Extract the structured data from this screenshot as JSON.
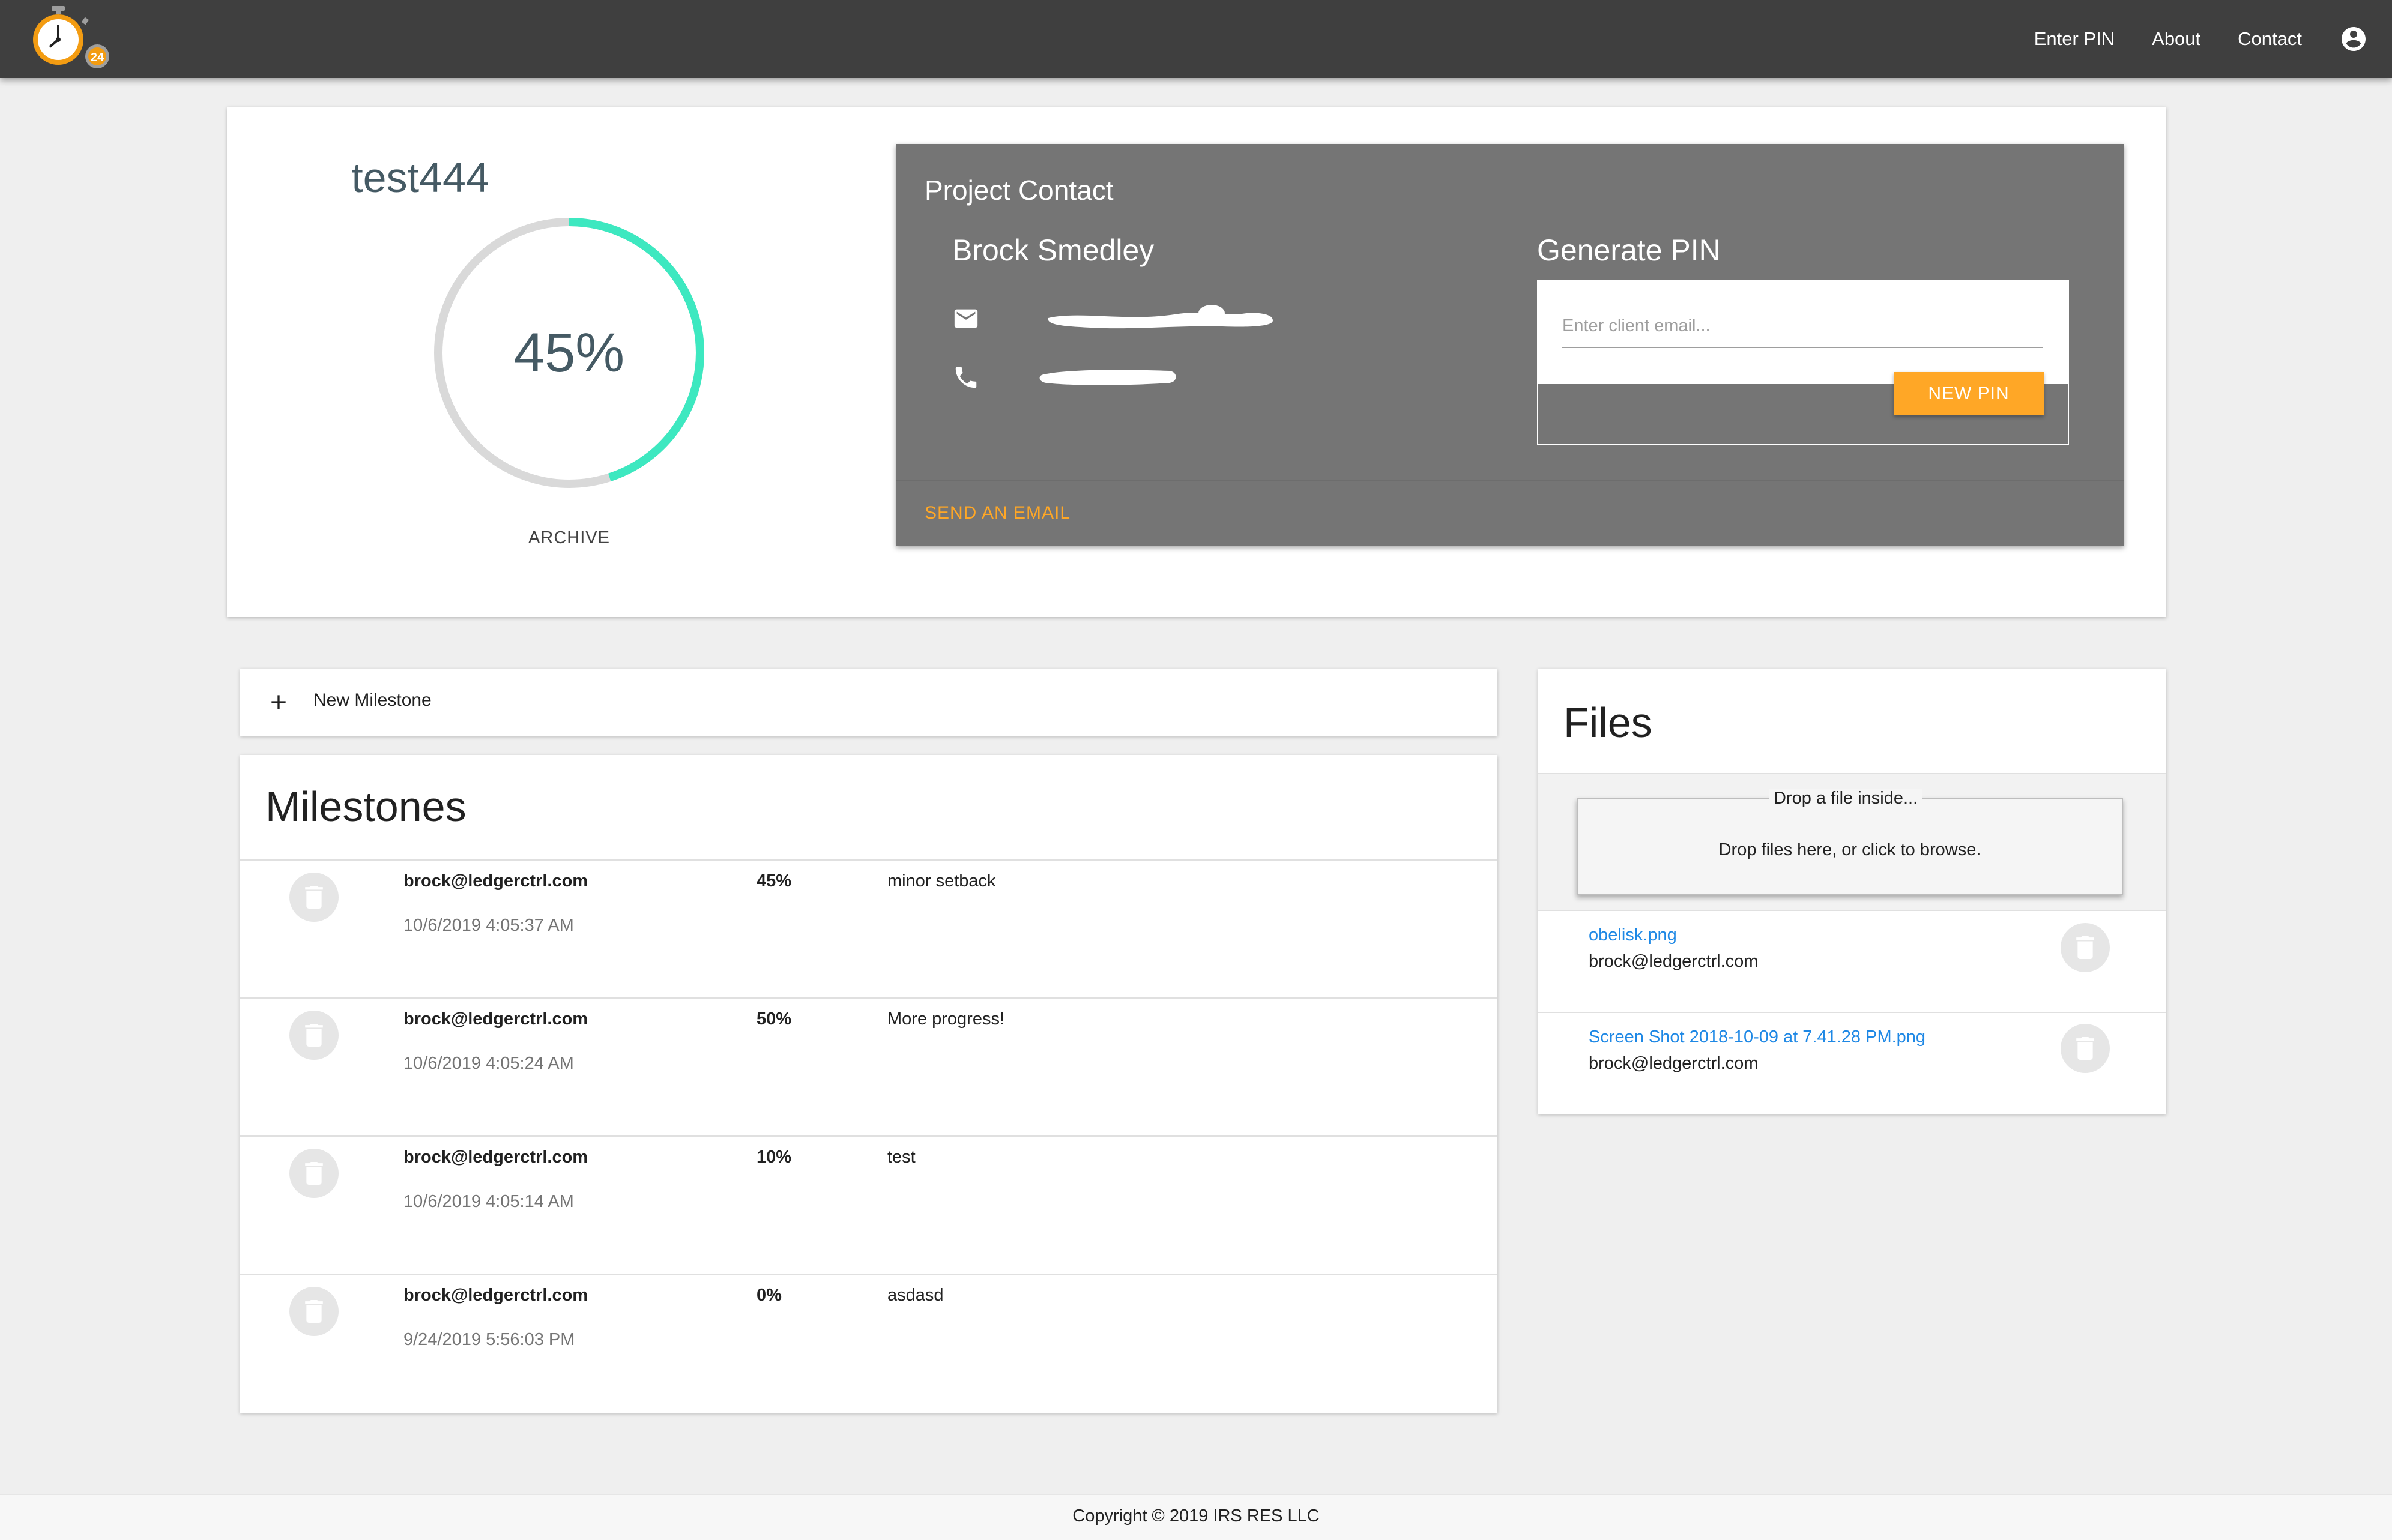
{
  "nav": {
    "items": [
      {
        "label": "Enter PIN"
      },
      {
        "label": "About"
      },
      {
        "label": "Contact"
      }
    ],
    "logo_badge": "24"
  },
  "project": {
    "name": "test444",
    "progress_text": "45%",
    "progress_fraction": 0.45,
    "archive_label": "ARCHIVE"
  },
  "contact": {
    "title": "Project Contact",
    "name": "Brock Smedley",
    "send_email_label": "SEND AN EMAIL"
  },
  "pin": {
    "title": "Generate PIN",
    "placeholder": "Enter client email...",
    "button_label": "NEW PIN"
  },
  "new_milestone": {
    "label": "New Milestone"
  },
  "milestones": {
    "title": "Milestones",
    "rows": [
      {
        "email": "brock@ledgerctrl.com",
        "date": "10/6/2019 4:05:37 AM",
        "percent": "45%",
        "note": "minor setback"
      },
      {
        "email": "brock@ledgerctrl.com",
        "date": "10/6/2019 4:05:24 AM",
        "percent": "50%",
        "note": "More progress!"
      },
      {
        "email": "brock@ledgerctrl.com",
        "date": "10/6/2019 4:05:14 AM",
        "percent": "10%",
        "note": "test"
      },
      {
        "email": "brock@ledgerctrl.com",
        "date": "9/24/2019 5:56:03 PM",
        "percent": "0%",
        "note": "asdasd"
      }
    ]
  },
  "files": {
    "title": "Files",
    "dropzone_legend": "Drop a file inside...",
    "dropzone_text": "Drop files here, or click to browse.",
    "items": [
      {
        "name": "obelisk.png",
        "owner": "brock@ledgerctrl.com"
      },
      {
        "name": "Screen Shot 2018-10-09 at 7.41.28 PM.png",
        "owner": "brock@ledgerctrl.com"
      }
    ]
  },
  "footer": {
    "text": "Copyright © 2019 IRS RES LLC"
  },
  "colors": {
    "topbar": "#3f3f3f",
    "accent_orange": "#ffa726",
    "progress_teal": "#3de8c0",
    "panel_gray": "#757575",
    "link_blue": "#1e88e5"
  },
  "icons": {
    "logo": "stopwatch-logo-icon",
    "account": "account-circle-icon",
    "mail": "mail-icon",
    "phone": "phone-icon",
    "plus": "plus-icon",
    "delete": "trash-icon"
  }
}
